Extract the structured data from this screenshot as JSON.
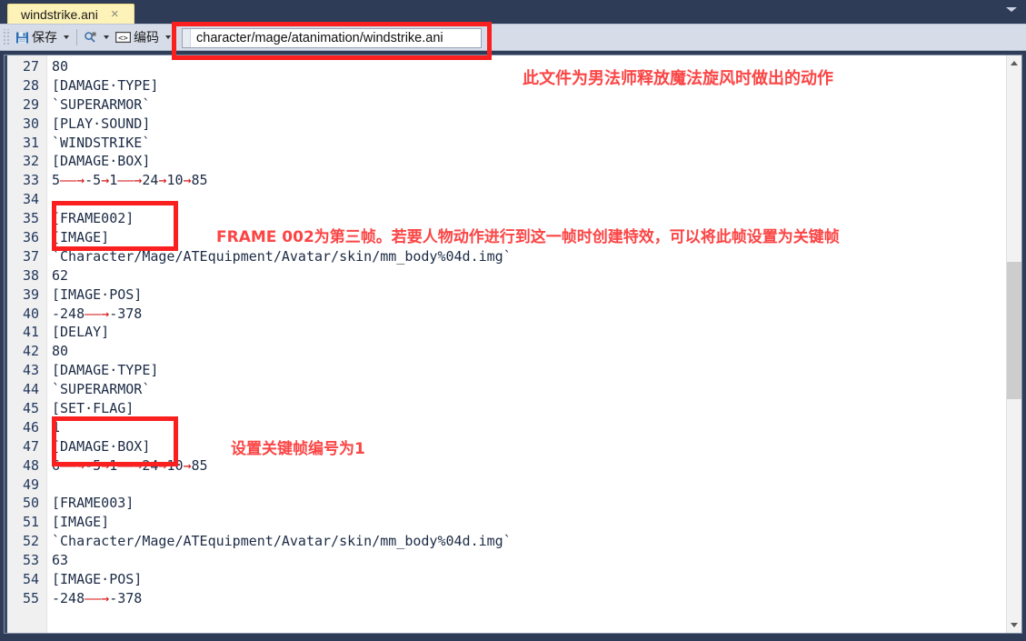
{
  "window": {
    "tab": {
      "label": "windstrike.ani",
      "close_label": "×"
    },
    "tabstrip_overflow_icon": "chevron-down-icon"
  },
  "toolbar": {
    "save_label": "保存",
    "encoding_label": "编码",
    "find_icon": "find-icon",
    "save_icon": "floppy-disk-icon",
    "code_icon": "angle-brackets-icon"
  },
  "path_box": {
    "value": "character/mage/atanimation/windstrike.ani"
  },
  "editor": {
    "first_line_number": 27,
    "lines": [
      {
        "n": 27,
        "segments": [
          {
            "t": "80"
          }
        ]
      },
      {
        "n": 28,
        "segments": [
          {
            "t": "[DAMAGE·TYPE]"
          }
        ]
      },
      {
        "n": 29,
        "segments": [
          {
            "t": "`SUPERARMOR`"
          }
        ]
      },
      {
        "n": 30,
        "segments": [
          {
            "t": "[PLAY·SOUND]"
          }
        ]
      },
      {
        "n": 31,
        "segments": [
          {
            "t": "`WINDSTRIKE`"
          }
        ]
      },
      {
        "n": 32,
        "segments": [
          {
            "t": "[DAMAGE·BOX]"
          }
        ]
      },
      {
        "n": 33,
        "segments": [
          {
            "t": "5"
          },
          {
            "t": "——→",
            "a": true
          },
          {
            "t": "-5"
          },
          {
            "t": "→",
            "a": true
          },
          {
            "t": "1"
          },
          {
            "t": "——→",
            "a": true
          },
          {
            "t": "24"
          },
          {
            "t": "→",
            "a": true
          },
          {
            "t": "10"
          },
          {
            "t": "→",
            "a": true
          },
          {
            "t": "85"
          }
        ]
      },
      {
        "n": 34,
        "segments": [
          {
            "t": ""
          }
        ]
      },
      {
        "n": 35,
        "segments": [
          {
            "t": "[FRAME002]"
          }
        ]
      },
      {
        "n": 36,
        "segments": [
          {
            "t": "[IMAGE]"
          }
        ]
      },
      {
        "n": 37,
        "segments": [
          {
            "t": "`Character/Mage/ATEquipment/Avatar/skin/mm_body%04d.img`"
          }
        ]
      },
      {
        "n": 38,
        "segments": [
          {
            "t": "62"
          }
        ]
      },
      {
        "n": 39,
        "segments": [
          {
            "t": "[IMAGE·POS]"
          }
        ]
      },
      {
        "n": 40,
        "segments": [
          {
            "t": "-248"
          },
          {
            "t": "——→",
            "a": true
          },
          {
            "t": "-378"
          }
        ]
      },
      {
        "n": 41,
        "segments": [
          {
            "t": "[DELAY]"
          }
        ]
      },
      {
        "n": 42,
        "segments": [
          {
            "t": "80"
          }
        ]
      },
      {
        "n": 43,
        "segments": [
          {
            "t": "[DAMAGE·TYPE]"
          }
        ]
      },
      {
        "n": 44,
        "segments": [
          {
            "t": "`SUPERARMOR`"
          }
        ]
      },
      {
        "n": 45,
        "segments": [
          {
            "t": "[SET·FLAG]"
          }
        ]
      },
      {
        "n": 46,
        "segments": [
          {
            "t": "1"
          }
        ]
      },
      {
        "n": 47,
        "segments": [
          {
            "t": "[DAMAGE·BOX]"
          }
        ]
      },
      {
        "n": 48,
        "segments": [
          {
            "t": "6"
          },
          {
            "t": "——→",
            "a": true
          },
          {
            "t": "-5"
          },
          {
            "t": "→",
            "a": true
          },
          {
            "t": "1"
          },
          {
            "t": "——→",
            "a": true
          },
          {
            "t": "24"
          },
          {
            "t": "→",
            "a": true
          },
          {
            "t": "10"
          },
          {
            "t": "→",
            "a": true
          },
          {
            "t": "85"
          }
        ]
      },
      {
        "n": 49,
        "segments": [
          {
            "t": ""
          }
        ]
      },
      {
        "n": 50,
        "segments": [
          {
            "t": "[FRAME003]"
          }
        ]
      },
      {
        "n": 51,
        "segments": [
          {
            "t": "[IMAGE]"
          }
        ]
      },
      {
        "n": 52,
        "segments": [
          {
            "t": "`Character/Mage/ATEquipment/Avatar/skin/mm_body%04d.img`"
          }
        ]
      },
      {
        "n": 53,
        "segments": [
          {
            "t": "63"
          }
        ]
      },
      {
        "n": 54,
        "segments": [
          {
            "t": "[IMAGE·POS]"
          }
        ]
      },
      {
        "n": 55,
        "segments": [
          {
            "t": "-248"
          },
          {
            "t": "——→",
            "a": true
          },
          {
            "t": "-378"
          }
        ]
      }
    ]
  },
  "annotations": {
    "accent_color": "#fb2020",
    "text_color": "#fb4545",
    "notes": [
      {
        "id": "note-file-purpose",
        "text": "此文件为男法师释放魔法旋风时做出的动作"
      },
      {
        "id": "note-frame002",
        "text": "FRAME 002为第三帧。若要人物动作进行到这一帧时创建特效，可以将此帧设置为关键帧"
      },
      {
        "id": "note-setflag",
        "text": "设置关键帧编号为1"
      }
    ]
  },
  "scrollbar": {
    "up_icon": "chevron-up-icon",
    "down_icon": "chevron-down-icon",
    "thumb_top_pct": 35,
    "thumb_height_pct": 25
  }
}
